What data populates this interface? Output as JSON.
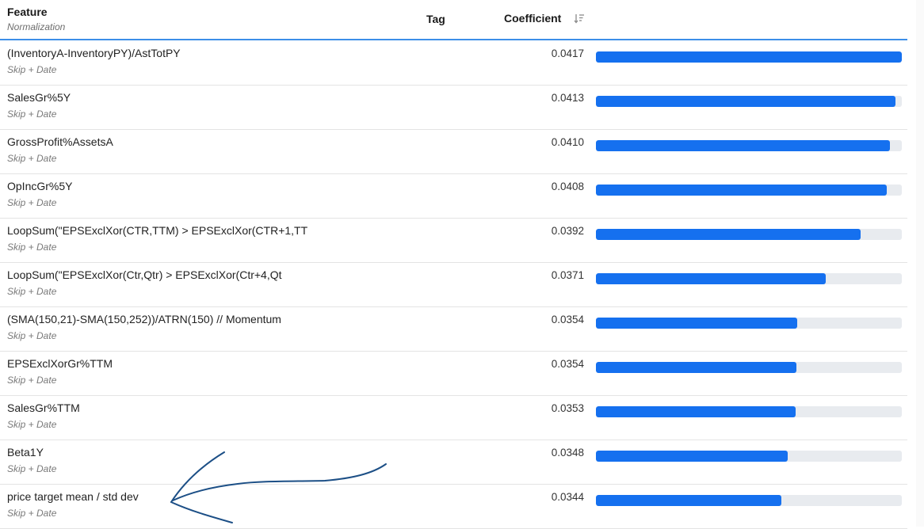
{
  "header": {
    "feature": "Feature",
    "normalization": "Normalization",
    "tag": "Tag",
    "coefficient": "Coefficient"
  },
  "colors": {
    "bar": "#1570ef",
    "track": "#e8ebef",
    "header_rule": "#3d8ee8",
    "annotation": "#1c4f86"
  },
  "rows": [
    {
      "name": "(InventoryA-InventoryPY)/AstTotPY",
      "norm": "Skip + Date",
      "value": "0.0417",
      "fill": 1.0
    },
    {
      "name": "SalesGr%5Y",
      "norm": "Skip + Date",
      "value": "0.0413",
      "fill": 0.98
    },
    {
      "name": "GrossProfit%AssetsA",
      "norm": "Skip + Date",
      "value": "0.0410",
      "fill": 0.962
    },
    {
      "name": "OpIncGr%5Y",
      "norm": "Skip + Date",
      "value": "0.0408",
      "fill": 0.95
    },
    {
      "name": "LoopSum(\"EPSExclXor(CTR,TTM) > EPSExclXor(CTR+1,TT",
      "norm": "Skip + Date",
      "value": "0.0392",
      "fill": 0.865
    },
    {
      "name": "LoopSum(\"EPSExclXor(Ctr,Qtr) > EPSExclXor(Ctr+4,Qt",
      "norm": "Skip + Date",
      "value": "0.0371",
      "fill": 0.752
    },
    {
      "name": "(SMA(150,21)-SMA(150,252))/ATRN(150) // Momentum",
      "norm": "Skip + Date",
      "value": "0.0354",
      "fill": 0.659
    },
    {
      "name": "EPSExclXorGr%TTM",
      "norm": "Skip + Date",
      "value": "0.0354",
      "fill": 0.656
    },
    {
      "name": "SalesGr%TTM",
      "norm": "Skip + Date",
      "value": "0.0353",
      "fill": 0.652
    },
    {
      "name": "Beta1Y",
      "norm": "Skip + Date",
      "value": "0.0348",
      "fill": 0.626
    },
    {
      "name": "price target mean / std dev",
      "norm": "Skip + Date",
      "value": "0.0344",
      "fill": 0.606
    }
  ]
}
